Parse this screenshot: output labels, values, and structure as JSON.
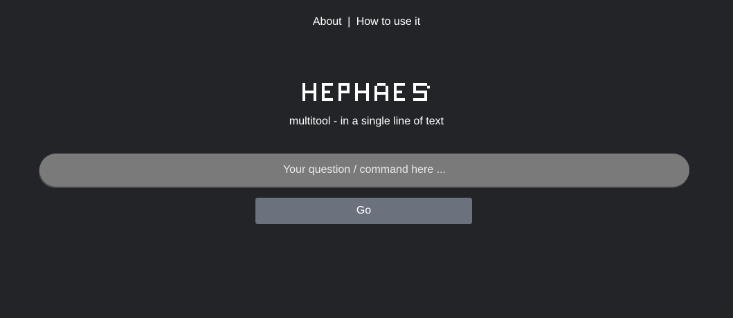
{
  "nav": {
    "about_label": "About",
    "separator": "|",
    "how_to_label": "How to use it"
  },
  "logo": {
    "text": "HEPHAES"
  },
  "subtitle": "multitool - in a single line of text",
  "search": {
    "placeholder": "Your question / command here ...",
    "value": ""
  },
  "go_button": {
    "label": "Go"
  },
  "colors": {
    "background": "#222428",
    "input_background": "#7a7a7a",
    "button_background": "#6b717d",
    "text": "#ffffff"
  }
}
